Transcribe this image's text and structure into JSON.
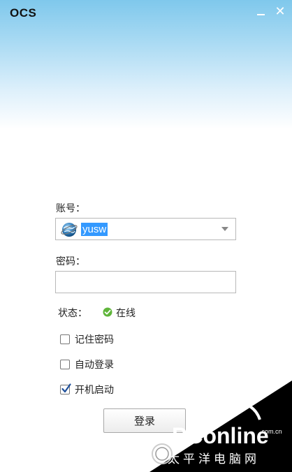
{
  "window": {
    "title": "OCS",
    "minimize": "minimize",
    "close": "✕"
  },
  "form": {
    "account_label": "账号：",
    "account_value": "yusw",
    "password_label": "密码：",
    "password_value": "",
    "status_label": "状态：",
    "status_value": "在线",
    "remember_label": "记住密码",
    "remember_checked": false,
    "autologin_label": "自动登录",
    "autologin_checked": false,
    "startup_label": "开机启动",
    "startup_checked": true,
    "login_button": "登录"
  },
  "watermark": {
    "brand": "PConline",
    "domain": ".com.cn",
    "tagline": "太平洋电脑网"
  },
  "colors": {
    "status_online": "#5fb53a",
    "selection": "#3399ff",
    "titlebar_top": "#7fc8ec"
  },
  "icons": {
    "status": "online-check-icon",
    "avatar": "globe-avatar-icon",
    "dropdown": "chevron-down-icon"
  }
}
